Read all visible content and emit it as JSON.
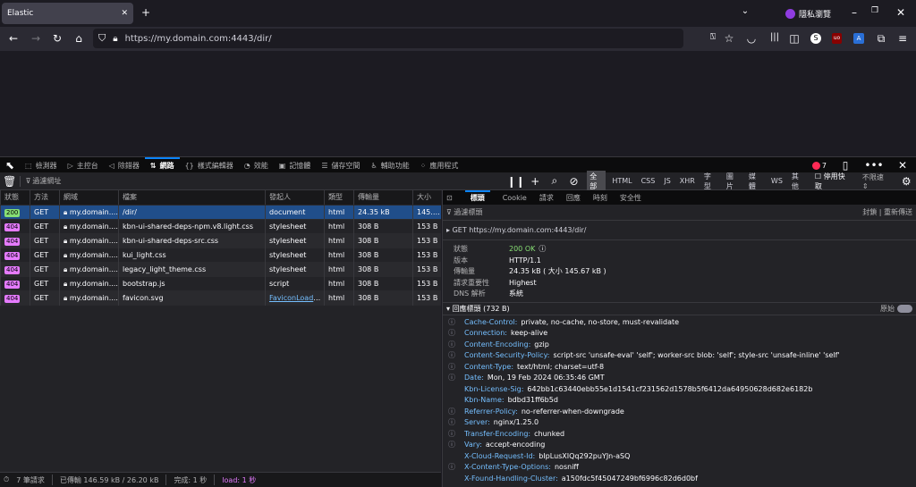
{
  "browser": {
    "tab_title": "Elastic",
    "url": "https://my.domain.com:4443/dir/",
    "private_label": "隱私瀏覽"
  },
  "devtools": {
    "tabs": [
      {
        "label": "檢測器",
        "icon": "inspector-icon",
        "glyph": "⬚"
      },
      {
        "label": "主控台",
        "icon": "console-icon",
        "glyph": "▷"
      },
      {
        "label": "除錯器",
        "icon": "debugger-icon",
        "glyph": "◁"
      },
      {
        "label": "網路",
        "icon": "network-icon",
        "glyph": "⇅",
        "active": true
      },
      {
        "label": "樣式編輯器",
        "icon": "style-editor-icon",
        "glyph": "{}"
      },
      {
        "label": "效能",
        "icon": "performance-icon",
        "glyph": "◔"
      },
      {
        "label": "記憶體",
        "icon": "memory-icon",
        "glyph": "▣"
      },
      {
        "label": "儲存空間",
        "icon": "storage-icon",
        "glyph": "☰"
      },
      {
        "label": "輔助功能",
        "icon": "accessibility-icon",
        "glyph": "♿"
      },
      {
        "label": "應用程式",
        "icon": "application-icon",
        "glyph": "⁘"
      }
    ],
    "error_count": "7",
    "filter_placeholder": "過濾網址",
    "type_filters": [
      "全部",
      "HTML",
      "CSS",
      "JS",
      "XHR",
      "字型",
      "圖片",
      "媒體",
      "WS",
      "其他"
    ],
    "disable_cache": "停用快取",
    "throttle": "不限速 ⇕"
  },
  "table": {
    "headers": [
      "狀態",
      "方法",
      "網域",
      "檔案",
      "發起人",
      "類型",
      "傳輸量",
      "大小"
    ],
    "rows": [
      [
        "200",
        "GET",
        "my.domain....",
        "/dir/",
        "document",
        "html",
        "24.35 kB",
        "145.6..."
      ],
      [
        "404",
        "GET",
        "my.domain....",
        "kbn-ui-shared-deps-npm.v8.light.css",
        "stylesheet",
        "html",
        "308 B",
        "153 B"
      ],
      [
        "404",
        "GET",
        "my.domain....",
        "kbn-ui-shared-deps-src.css",
        "stylesheet",
        "html",
        "308 B",
        "153 B"
      ],
      [
        "404",
        "GET",
        "my.domain....",
        "kui_light.css",
        "stylesheet",
        "html",
        "308 B",
        "153 B"
      ],
      [
        "404",
        "GET",
        "my.domain....",
        "legacy_light_theme.css",
        "stylesheet",
        "html",
        "308 B",
        "153 B"
      ],
      [
        "404",
        "GET",
        "my.domain....",
        "bootstrap.js",
        "script",
        "html",
        "308 B",
        "153 B"
      ],
      [
        "404",
        "GET",
        "my.domain....",
        "favicon.svg",
        "FaviconLoader....",
        "html",
        "308 B",
        "153 B"
      ]
    ]
  },
  "status_bar": {
    "requests": "7 筆請求",
    "transferred": "已傳輸 146.59 kB / 26.20 kB",
    "finish": "完成: 1 秒",
    "load": "load: 1 秒"
  },
  "details": {
    "tabs": [
      "標頭",
      "Cookie",
      "請求",
      "回應",
      "時刻",
      "安全性"
    ],
    "filter_placeholder": "過濾標頭",
    "block": "封鎖",
    "resend": "重新傳送",
    "request_line": "GET https://my.domain.com:4443/dir/",
    "summary": [
      [
        "狀態",
        "200 OK"
      ],
      [
        "版本",
        "HTTP/1.1"
      ],
      [
        "傳輸量",
        "24.35 kB ( 大小 145.67 kB )"
      ],
      [
        "請求重要性",
        "Highest"
      ],
      [
        "DNS 解析",
        "系統"
      ]
    ],
    "response_headers_title": "回應標頭 (732 B)",
    "raw_label": "原始",
    "headers": [
      [
        "Cache-Control:",
        "private, no-cache, no-store, must-revalidate",
        true
      ],
      [
        "Connection:",
        "keep-alive",
        true
      ],
      [
        "Content-Encoding:",
        "gzip",
        true
      ],
      [
        "Content-Security-Policy:",
        "script-src 'unsafe-eval' 'self'; worker-src blob: 'self'; style-src 'unsafe-inline' 'self'",
        true
      ],
      [
        "Content-Type:",
        "text/html; charset=utf-8",
        true
      ],
      [
        "Date:",
        "Mon, 19 Feb 2024 06:35:46 GMT",
        true
      ],
      [
        "Kbn-License-Sig:",
        "642bb1c63440ebb55e1d1541cf231562d1578b5f6412da64950628d682e6182b",
        false
      ],
      [
        "Kbn-Name:",
        "bdbd31ff6b5d",
        false
      ],
      [
        "Referrer-Policy:",
        "no-referrer-when-downgrade",
        true
      ],
      [
        "Server:",
        "nginx/1.25.0",
        true
      ],
      [
        "Transfer-Encoding:",
        "chunked",
        true
      ],
      [
        "Vary:",
        "accept-encoding",
        true
      ],
      [
        "X-Cloud-Request-Id:",
        "bIpLusXIQq292puYJn-aSQ",
        false
      ],
      [
        "X-Content-Type-Options:",
        "nosniff",
        true
      ],
      [
        "X-Found-Handling-Cluster:",
        "a150fdc5f45047249bf6996c82d6d0bf",
        false
      ]
    ]
  },
  "colors": {
    "ok": "#87de74",
    "notfound": "#e57bff",
    "link": "#75bfff",
    "selected": "#204e8a",
    "load": "#e57bff"
  }
}
